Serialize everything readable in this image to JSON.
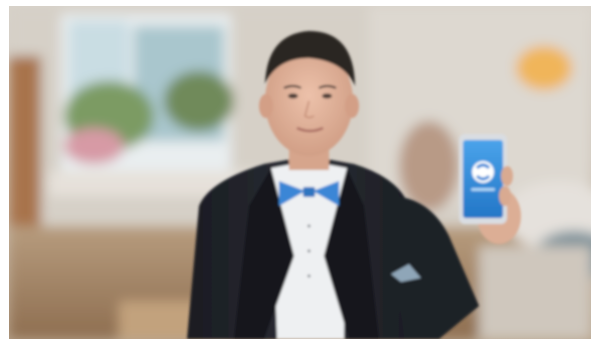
{
  "scene": {
    "description_free": true,
    "phone_screen_label": "",
    "colors": {
      "wall": "#d7d1c8",
      "window_light": "#eef2f4",
      "curtain_teal": "#7fa7b0",
      "plant_green": "#6f8a5a",
      "floor_wood": "#9a7b5c",
      "suit": "#1f2127",
      "shirt": "#f1f2f3",
      "bow_tie": "#3b86d6",
      "skin": "#e0b49d",
      "hair": "#2a2523",
      "phone_screen": "#2f86d8",
      "lamp": "#f0b55a"
    },
    "icons": {
      "phone_app_logo": "app-logo-icon"
    }
  }
}
